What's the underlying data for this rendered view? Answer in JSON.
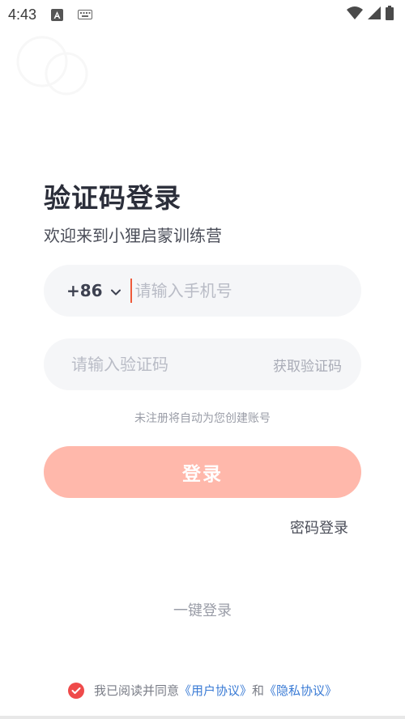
{
  "status_bar": {
    "time": "4:43",
    "icons": [
      "font-a-icon",
      "keyboard-icon",
      "wifi-icon",
      "signal-icon",
      "battery-icon"
    ]
  },
  "login": {
    "title": "验证码登录",
    "subtitle": "欢迎来到小狸启蒙训练营",
    "country_code": "+86",
    "phone_placeholder": "请输入手机号",
    "code_placeholder": "请输入验证码",
    "get_code": "获取验证码",
    "hint": "未注册将自动为您创建账号",
    "login_button": "登录",
    "password_login": "密码登录",
    "one_key_login": "一键登录"
  },
  "agreement": {
    "prefix": "我已阅读并同意",
    "user_agreement": "《用户协议》",
    "and": "和",
    "privacy_agreement": "《隐私协议》",
    "checked": true
  },
  "colors": {
    "accent": "#ffb8ab",
    "caret": "#ee5a3a",
    "link": "#3a7bd5",
    "check": "#ef4a4a"
  }
}
